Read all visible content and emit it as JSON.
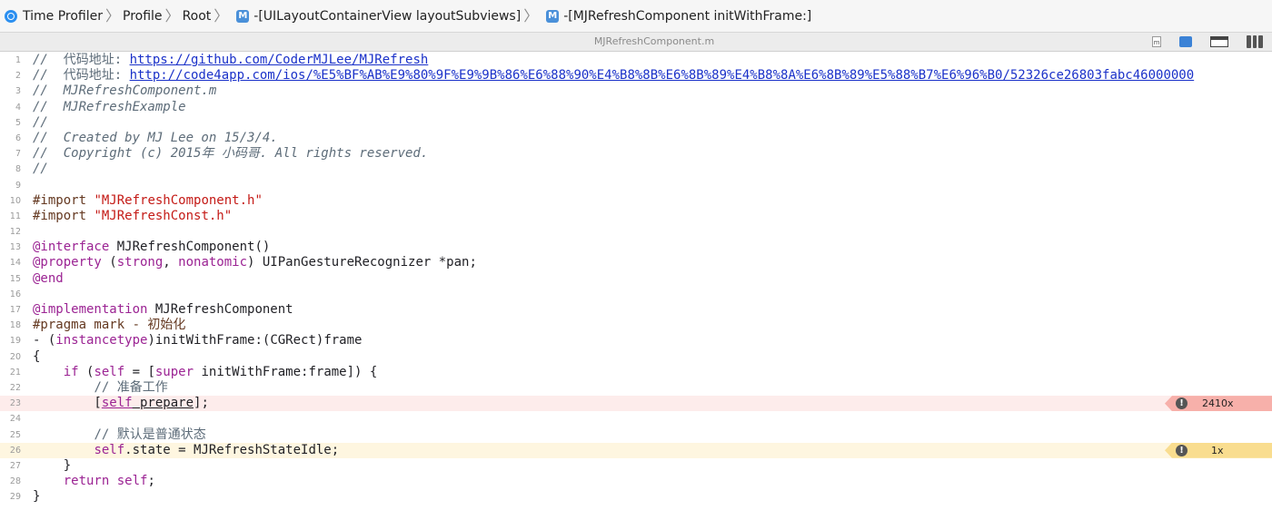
{
  "breadcrumb": {
    "items": [
      {
        "label": "Time Profiler",
        "icon": "time-profiler-icon"
      },
      {
        "label": "Profile"
      },
      {
        "label": "Root"
      },
      {
        "label": "-[UILayoutContainerView layoutSubviews]",
        "icon": "method-icon",
        "icon_text": "M"
      },
      {
        "label": "-[MJRefreshComponent initWithFrame:]",
        "icon": "method-icon",
        "icon_text": "M"
      }
    ]
  },
  "file": {
    "name": "MJRefreshComponent.m",
    "doc_icon_text": "m"
  },
  "code": {
    "lines": [
      {
        "n": "1",
        "segs": [
          {
            "c": "cm",
            "t": "//  "
          },
          {
            "c": "cmz",
            "t": "代码地址: "
          },
          {
            "c": "url",
            "t": "https://github.com/CoderMJLee/MJRefresh"
          }
        ]
      },
      {
        "n": "2",
        "segs": [
          {
            "c": "cm",
            "t": "//  "
          },
          {
            "c": "cmz",
            "t": "代码地址: "
          },
          {
            "c": "url",
            "t": "http://code4app.com/ios/%E5%BF%AB%E9%80%9F%E9%9B%86%E6%88%90%E4%B8%8B%E6%8B%89%E4%B8%8A%E6%8B%89%E5%88%B7%E6%96%B0/52326ce26803fabc46000000"
          }
        ]
      },
      {
        "n": "3",
        "segs": [
          {
            "c": "cm",
            "t": "//  MJRefreshComponent.m"
          }
        ]
      },
      {
        "n": "4",
        "segs": [
          {
            "c": "cm",
            "t": "//  MJRefreshExample"
          }
        ]
      },
      {
        "n": "5",
        "segs": [
          {
            "c": "cm",
            "t": "//"
          }
        ]
      },
      {
        "n": "6",
        "segs": [
          {
            "c": "cm",
            "t": "//  Created by MJ Lee on 15/3/4."
          }
        ]
      },
      {
        "n": "7",
        "segs": [
          {
            "c": "cm",
            "t": "//  Copyright (c) 2015年 小码哥. All rights reserved."
          }
        ]
      },
      {
        "n": "8",
        "segs": [
          {
            "c": "cm",
            "t": "//"
          }
        ]
      },
      {
        "n": "9",
        "segs": []
      },
      {
        "n": "10",
        "segs": [
          {
            "c": "pp",
            "t": "#import "
          },
          {
            "c": "str",
            "t": "\"MJRefreshComponent.h\""
          }
        ]
      },
      {
        "n": "11",
        "segs": [
          {
            "c": "pp",
            "t": "#import "
          },
          {
            "c": "str",
            "t": "\"MJRefreshConst.h\""
          }
        ]
      },
      {
        "n": "12",
        "segs": []
      },
      {
        "n": "13",
        "segs": [
          {
            "c": "kw",
            "t": "@interface"
          },
          {
            "c": "txt",
            "t": " MJRefreshComponent()"
          }
        ]
      },
      {
        "n": "14",
        "segs": [
          {
            "c": "kw",
            "t": "@property"
          },
          {
            "c": "txt",
            "t": " ("
          },
          {
            "c": "kw",
            "t": "strong"
          },
          {
            "c": "txt",
            "t": ", "
          },
          {
            "c": "kw",
            "t": "nonatomic"
          },
          {
            "c": "txt",
            "t": ") UIPanGestureRecognizer *pan;"
          }
        ]
      },
      {
        "n": "15",
        "segs": [
          {
            "c": "kw",
            "t": "@end"
          }
        ]
      },
      {
        "n": "16",
        "segs": []
      },
      {
        "n": "17",
        "segs": [
          {
            "c": "kw",
            "t": "@implementation"
          },
          {
            "c": "txt",
            "t": " MJRefreshComponent"
          }
        ]
      },
      {
        "n": "18",
        "segs": [
          {
            "c": "pp",
            "t": "#pragma mark - 初始化"
          }
        ]
      },
      {
        "n": "19",
        "segs": [
          {
            "c": "txt",
            "t": "- ("
          },
          {
            "c": "kw",
            "t": "instancetype"
          },
          {
            "c": "txt",
            "t": ")initWithFrame:(CGRect)frame"
          }
        ]
      },
      {
        "n": "20",
        "segs": [
          {
            "c": "txt",
            "t": "{"
          }
        ]
      },
      {
        "n": "21",
        "segs": [
          {
            "c": "txt",
            "t": "    "
          },
          {
            "c": "kw",
            "t": "if"
          },
          {
            "c": "txt",
            "t": " ("
          },
          {
            "c": "kw",
            "t": "self"
          },
          {
            "c": "txt",
            "t": " = ["
          },
          {
            "c": "kw",
            "t": "super"
          },
          {
            "c": "txt",
            "t": " initWithFrame:frame]) {"
          }
        ]
      },
      {
        "n": "22",
        "segs": [
          {
            "c": "txt",
            "t": "        "
          },
          {
            "c": "cmz",
            "t": "// 准备工作"
          }
        ]
      },
      {
        "n": "23",
        "hl": "hot",
        "badge": {
          "tone": "red",
          "count": "2410x"
        },
        "segs": [
          {
            "c": "txt",
            "t": "        ["
          },
          {
            "c": "kw underline",
            "t": "self"
          },
          {
            "c": "txt underline",
            "t": " prepare"
          },
          {
            "c": "txt",
            "t": "];"
          }
        ]
      },
      {
        "n": "24",
        "segs": []
      },
      {
        "n": "25",
        "segs": [
          {
            "c": "txt",
            "t": "        "
          },
          {
            "c": "cmz",
            "t": "// 默认是普通状态"
          }
        ]
      },
      {
        "n": "26",
        "hl": "warm",
        "badge": {
          "tone": "yellow",
          "count": "1x"
        },
        "segs": [
          {
            "c": "txt",
            "t": "        "
          },
          {
            "c": "kw",
            "t": "self"
          },
          {
            "c": "txt",
            "t": ".state = MJRefreshStateIdle;"
          }
        ]
      },
      {
        "n": "27",
        "segs": [
          {
            "c": "txt",
            "t": "    }"
          }
        ]
      },
      {
        "n": "28",
        "segs": [
          {
            "c": "txt",
            "t": "    "
          },
          {
            "c": "kw",
            "t": "return"
          },
          {
            "c": "txt",
            "t": " "
          },
          {
            "c": "kw",
            "t": "self"
          },
          {
            "c": "txt",
            "t": ";"
          }
        ]
      },
      {
        "n": "29",
        "segs": [
          {
            "c": "txt",
            "t": "}"
          }
        ]
      }
    ]
  },
  "badge_icon": "warning-icon",
  "badge_icon_text": "!",
  "colors": {
    "hot_line": "#fdeceb",
    "warm_line": "#fef6e0",
    "hot_badge": "#f7b0aa",
    "warm_badge": "#f9dd8f",
    "keyword": "#9b2393",
    "string": "#c41a16",
    "comment": "#5d6c79",
    "link": "#1a31c9"
  }
}
